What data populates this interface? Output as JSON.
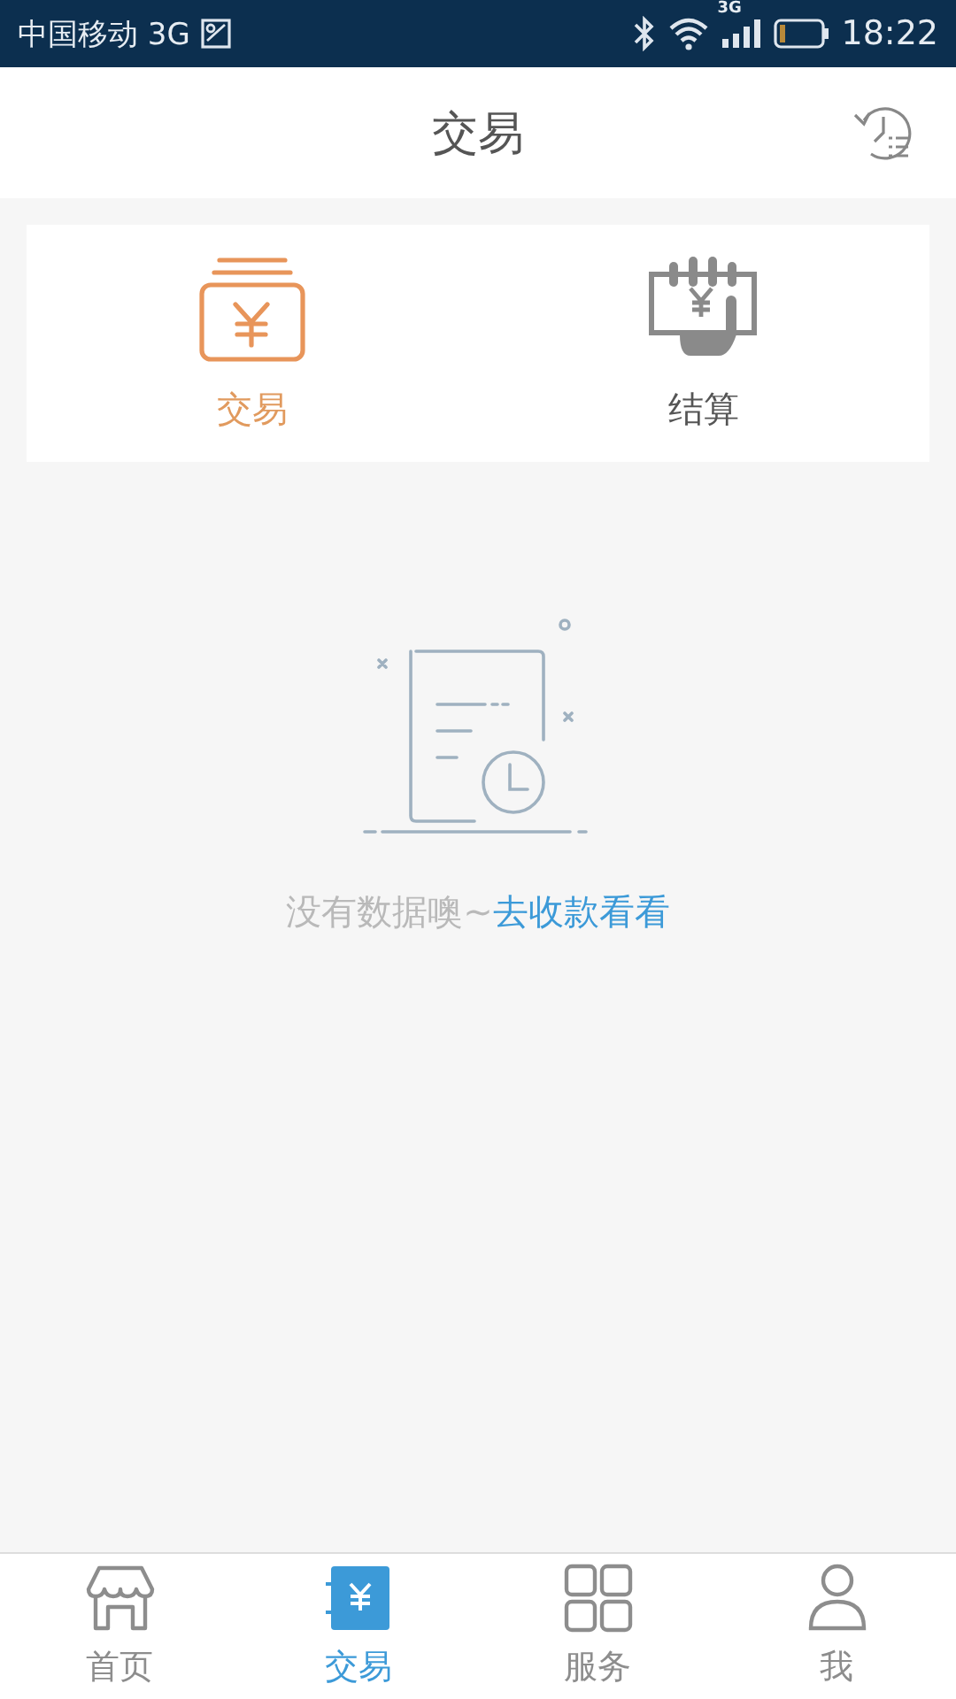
{
  "status_bar": {
    "carrier": "中国移动 3G",
    "network": "3G",
    "time": "18:22"
  },
  "header": {
    "title": "交易"
  },
  "segments": [
    {
      "label": "交易",
      "kind": "yuan-card",
      "selected": true
    },
    {
      "label": "结算",
      "kind": "hand-bill",
      "selected": false
    }
  ],
  "empty_state": {
    "message": "没有数据噢~",
    "link": "去收款看看"
  },
  "tab_bar": [
    {
      "label": "首页",
      "kind": "store",
      "selected": false
    },
    {
      "label": "交易",
      "kind": "yuan",
      "selected": true
    },
    {
      "label": "服务",
      "kind": "grid",
      "selected": false
    },
    {
      "label": "我",
      "kind": "person",
      "selected": false
    }
  ]
}
